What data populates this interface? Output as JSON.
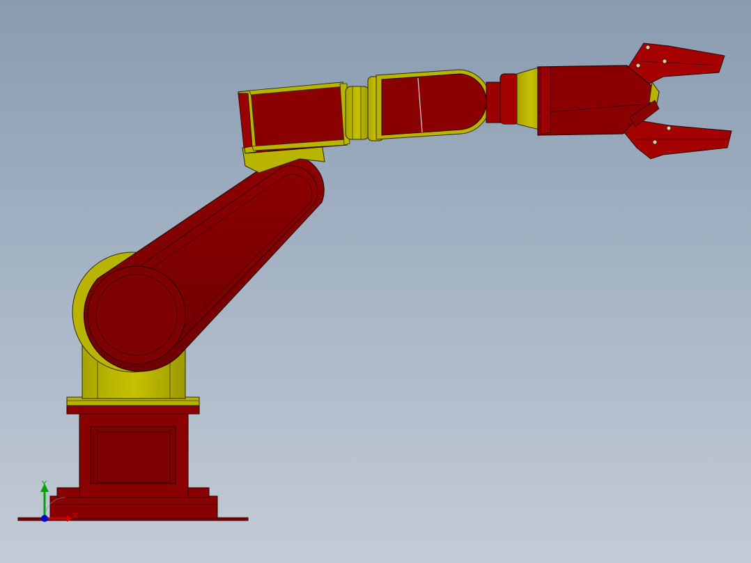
{
  "viewport": {
    "background_top": "#8a9bb0",
    "background_bottom": "#c3ccd6"
  },
  "model": {
    "primary_color": "#7f0000",
    "accent_color": "#b8b400",
    "edge_color": "#1a1a00"
  },
  "triad": {
    "x_label": "X",
    "y_label": "Y",
    "x_color": "#cc0000",
    "y_color": "#00a000",
    "z_color": "#0000cc"
  }
}
